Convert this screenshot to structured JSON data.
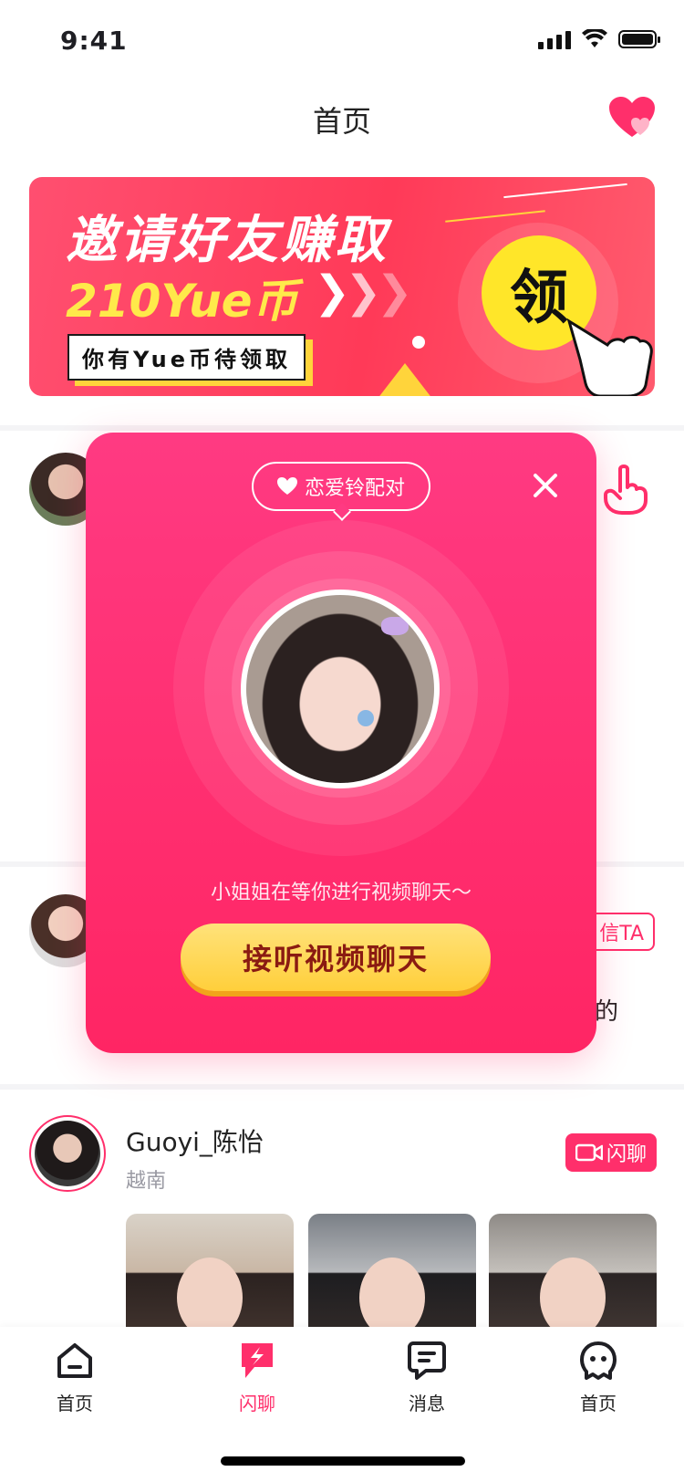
{
  "status": {
    "time": "9:41"
  },
  "nav": {
    "title": "首页"
  },
  "banner": {
    "title": "邀请好友赚取",
    "amount": "210Yue币",
    "tag": "你有Yue币待领取",
    "claim_label": "领"
  },
  "feed": {
    "row2_button": "信TA",
    "row2_text_fragment": "的",
    "user3": {
      "name": "Guoyi_陈怡",
      "location": "越南",
      "flash_chat_label": "闪聊"
    }
  },
  "modal": {
    "badge_label": "恋爱铃配对",
    "subtitle": "小姐姐在等你进行视频聊天～",
    "action_label": "接听视频聊天"
  },
  "tabs": [
    {
      "label": "首页",
      "icon": "home-icon",
      "active": false
    },
    {
      "label": "闪聊",
      "icon": "flash-chat-icon",
      "active": true
    },
    {
      "label": "消息",
      "icon": "message-icon",
      "active": false
    },
    {
      "label": "首页",
      "icon": "ghost-profile-icon",
      "active": false
    }
  ],
  "colors": {
    "accent": "#ff2f6b",
    "banner": "#ff4466",
    "gold": "#ffd43b"
  }
}
